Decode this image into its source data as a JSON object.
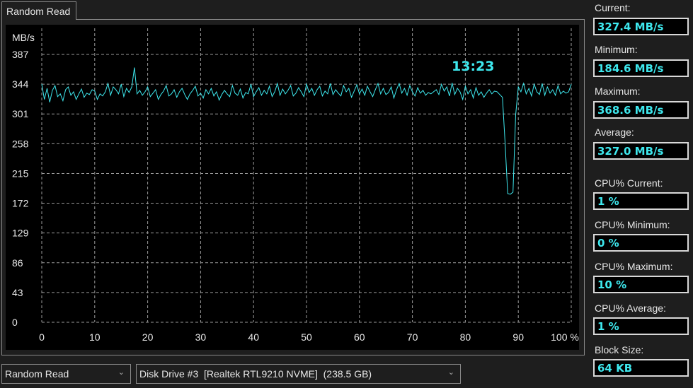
{
  "tab": "Random Read",
  "time": "13:23",
  "line_color": "#3ee8ee",
  "selectors": {
    "test": "Random Read",
    "drive": "Disk Drive #3  [Realtek RTL9210 NVME]  (238.5 GB)"
  },
  "stats": [
    {
      "label": "Current:",
      "value": "327.4 MB/s"
    },
    {
      "label": "Minimum:",
      "value": "184.6 MB/s"
    },
    {
      "label": "Maximum:",
      "value": "368.6 MB/s"
    },
    {
      "label": "Average:",
      "value": "327.0 MB/s"
    },
    {
      "label": "CPU% Current:",
      "value": "1 %"
    },
    {
      "label": "CPU% Minimum:",
      "value": "0 %"
    },
    {
      "label": "CPU% Maximum:",
      "value": "10 %"
    },
    {
      "label": "CPU% Average:",
      "value": "1 %"
    },
    {
      "label": "Block Size:",
      "value": "64 KB"
    }
  ],
  "chart_data": {
    "type": "line",
    "ylabel": "MB/s",
    "ylim": [
      0,
      387
    ],
    "xlim": [
      0,
      100
    ],
    "yticks": [
      "0",
      "43",
      "86",
      "129",
      "172",
      "215",
      "258",
      "301",
      "344",
      "387"
    ],
    "xticks": [
      "0",
      "10",
      "20",
      "30",
      "40",
      "50",
      "60",
      "70",
      "80",
      "90",
      "100 %"
    ],
    "x_step": 0.5,
    "values": [
      344,
      322,
      338,
      318,
      335,
      342,
      326,
      330,
      320,
      336,
      340,
      328,
      333,
      322,
      330,
      337,
      325,
      331,
      329,
      336,
      334,
      322,
      330,
      327,
      333,
      345,
      328,
      340,
      336,
      330,
      344,
      326,
      338,
      332,
      340,
      368,
      330,
      335,
      328,
      333,
      340,
      326,
      331,
      336,
      322,
      329,
      334,
      342,
      327,
      330,
      336,
      325,
      333,
      338,
      329,
      322,
      330,
      335,
      341,
      327,
      331,
      324,
      336,
      330,
      338,
      327,
      333,
      321,
      329,
      335,
      330,
      326,
      342,
      331,
      328,
      337,
      324,
      332,
      330,
      344,
      326,
      333,
      339,
      328,
      335,
      330,
      341,
      326,
      333,
      345,
      328,
      337,
      330,
      335,
      342,
      327,
      331,
      339,
      333,
      326,
      344,
      332,
      338,
      328,
      336,
      341,
      327,
      334,
      330,
      345,
      329,
      336,
      331,
      327,
      342,
      333,
      338,
      325,
      334,
      343,
      330,
      337,
      328,
      341,
      333,
      326,
      336,
      345,
      330,
      338,
      329,
      332,
      340,
      324,
      336,
      345,
      331,
      338,
      328,
      342,
      333,
      327,
      339,
      331,
      335,
      328,
      332,
      330,
      333,
      336,
      329,
      344,
      334,
      340,
      327,
      346,
      329,
      338,
      333,
      322,
      341,
      330,
      336,
      324,
      339,
      328,
      333,
      325,
      331,
      336,
      330,
      334,
      333,
      329,
      325,
      260,
      186,
      185,
      188,
      300,
      340,
      333,
      345,
      330,
      338,
      327,
      344,
      333,
      329,
      345,
      328,
      340,
      331,
      336,
      328,
      342,
      330,
      334,
      331,
      333,
      344
    ]
  }
}
